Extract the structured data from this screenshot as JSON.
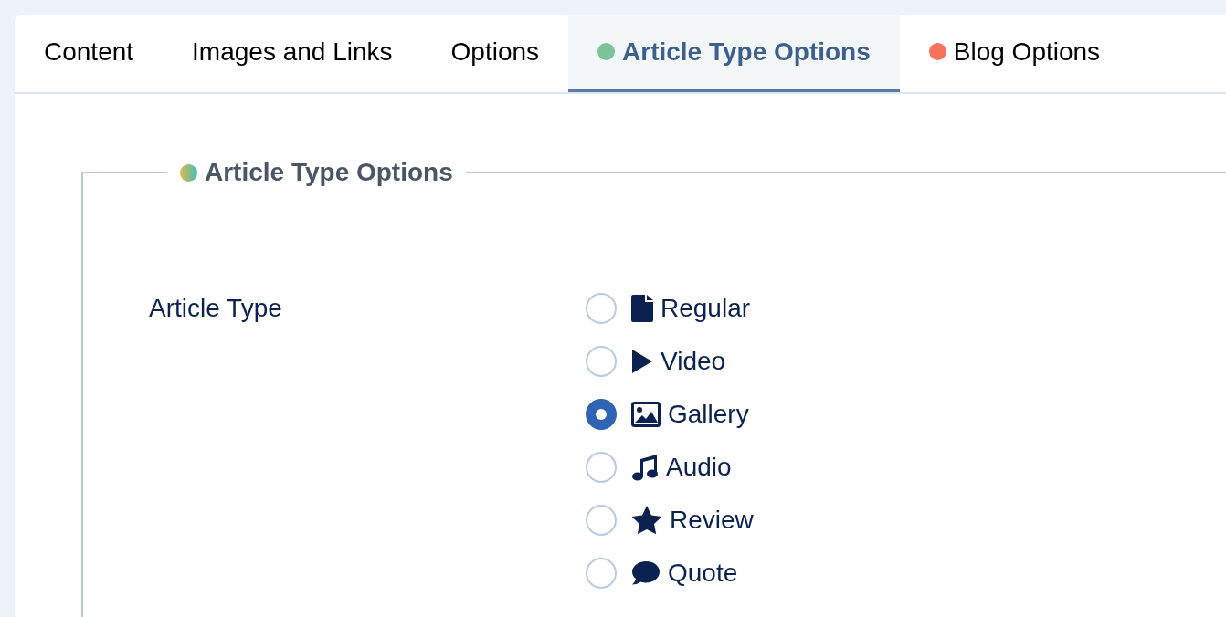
{
  "tabs": [
    {
      "label": "Content",
      "selected": false
    },
    {
      "label": "Images and Links",
      "selected": false
    },
    {
      "label": "Options",
      "selected": false
    },
    {
      "label": "Article Type Options",
      "selected": true,
      "color": "#7cc39a"
    },
    {
      "label": "Blog Options",
      "selected": false,
      "color": "#f8735e"
    }
  ],
  "fieldset": {
    "legend": "Article Type Options",
    "field": {
      "label": "Article Type",
      "options": [
        {
          "label": "Regular",
          "kind": "file",
          "selected": false
        },
        {
          "label": "Video",
          "kind": "play",
          "selected": false
        },
        {
          "label": "Gallery",
          "kind": "image",
          "selected": true
        },
        {
          "label": "Audio",
          "kind": "music",
          "selected": false
        },
        {
          "label": "Review",
          "kind": "star",
          "selected": false
        },
        {
          "label": "Quote",
          "kind": "comment",
          "selected": false
        }
      ]
    }
  }
}
